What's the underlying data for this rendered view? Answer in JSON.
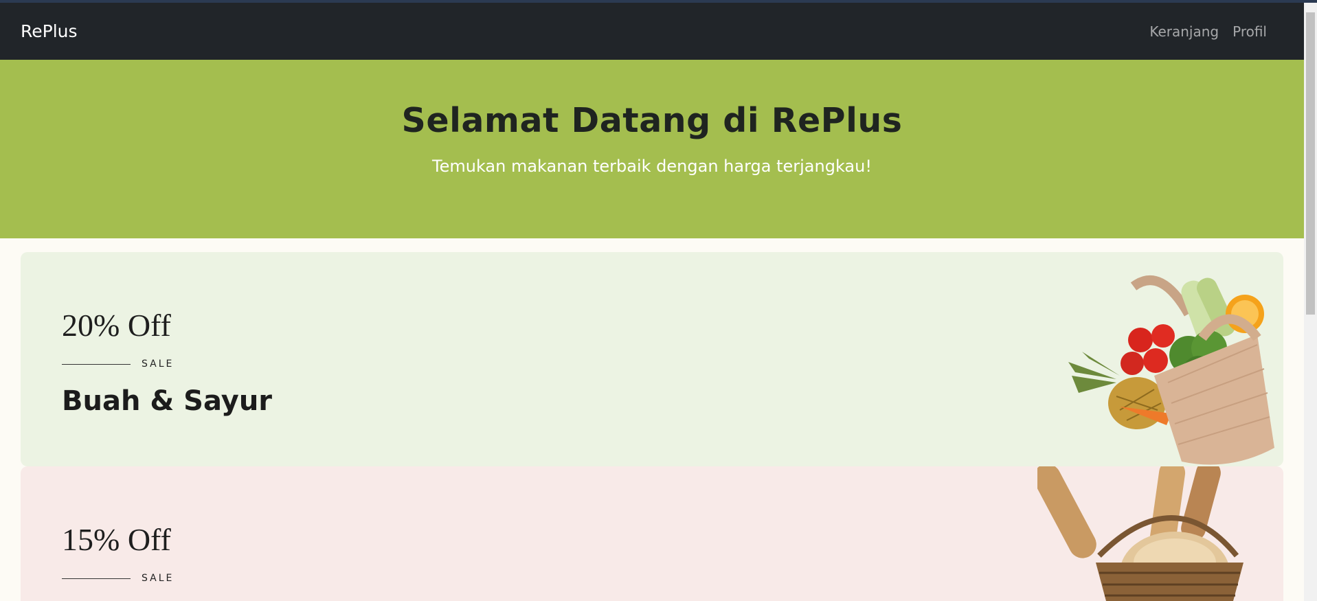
{
  "navbar": {
    "brand": "RePlus",
    "links": [
      {
        "label": "Keranjang"
      },
      {
        "label": "Profil"
      }
    ]
  },
  "hero": {
    "title": "Selamat Datang di RePlus",
    "subtitle": "Temukan makanan terbaik dengan harga terjangkau!"
  },
  "banners": [
    {
      "offer": "20% Off",
      "sale": "SALE",
      "category": "Buah & Sayur",
      "image": "vegetable-bag-image"
    },
    {
      "offer": "15% Off",
      "sale": "SALE",
      "image": "bread-basket-image"
    }
  ],
  "colors": {
    "navbar": "#212529",
    "hero": "#a4be4f",
    "banner_green": "#ecf3e3",
    "banner_pink": "#f8eae8"
  }
}
